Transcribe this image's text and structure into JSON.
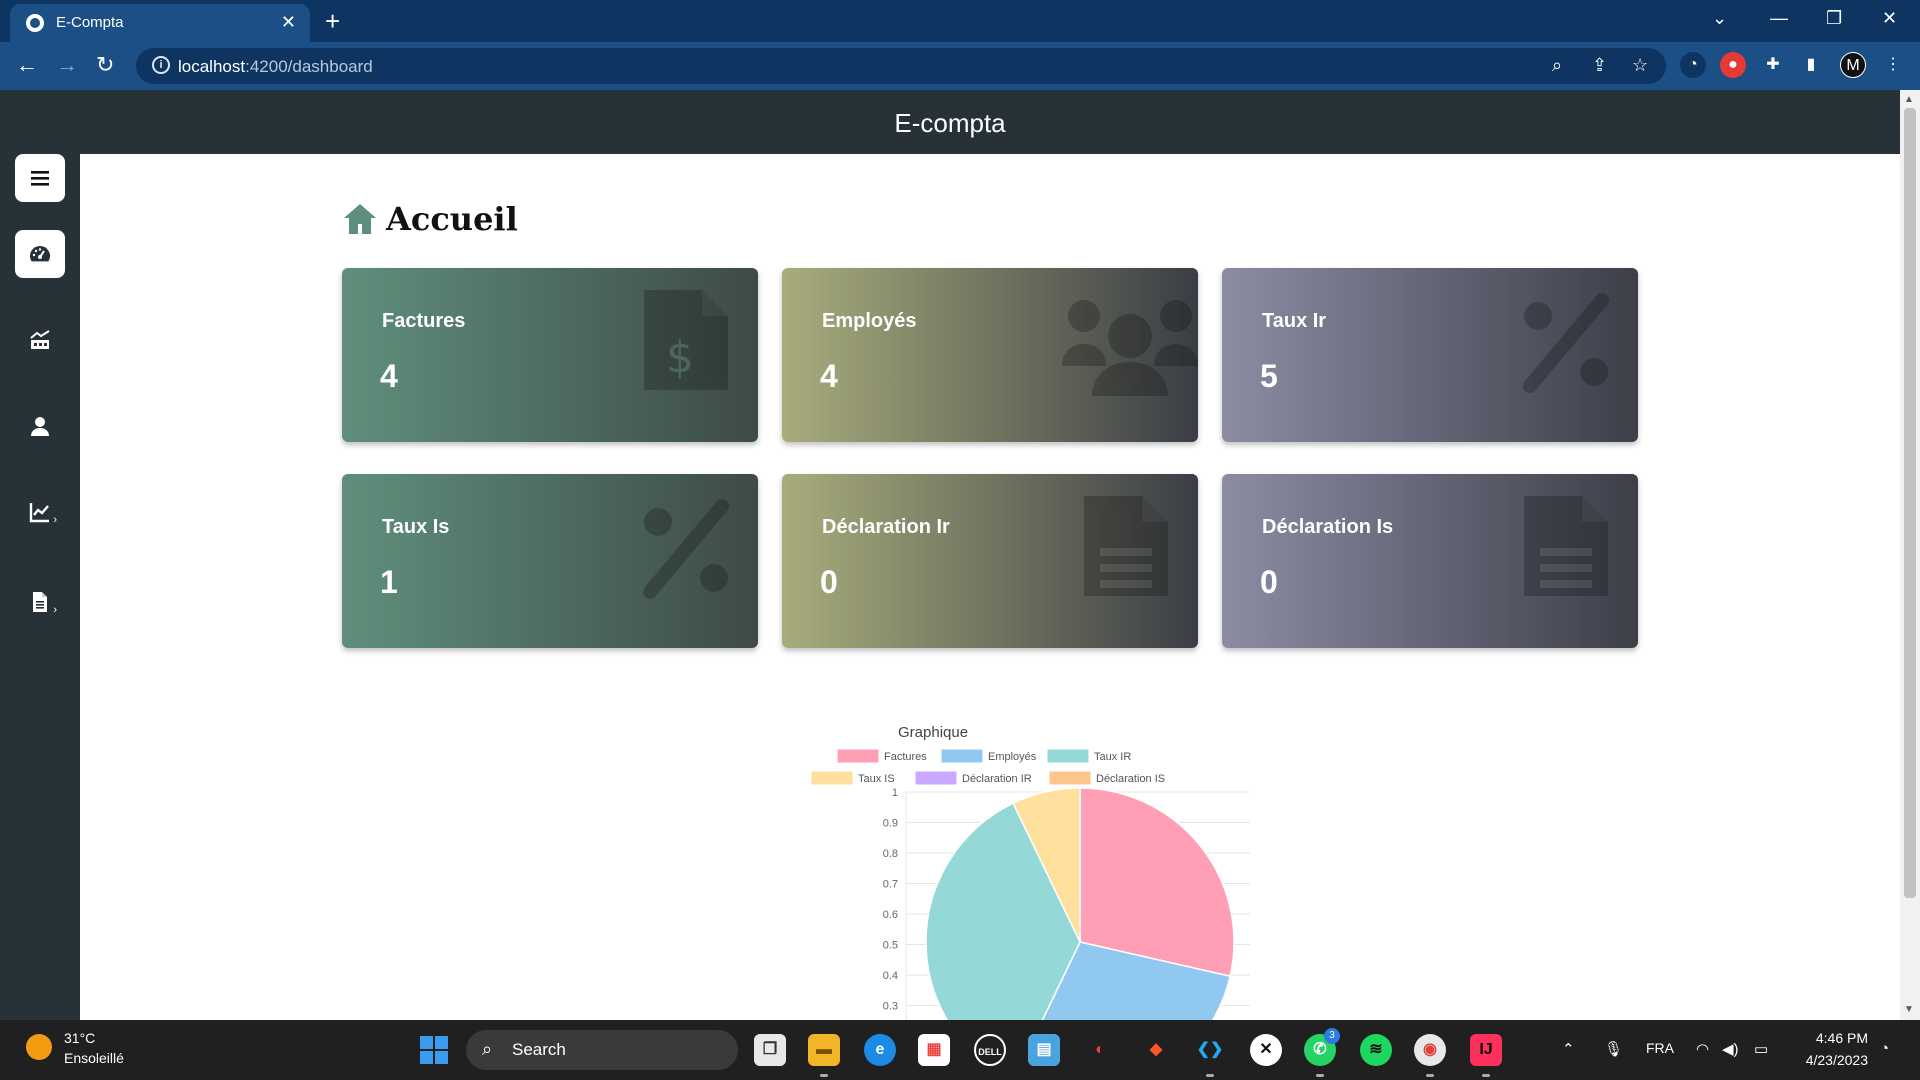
{
  "browser": {
    "tab_title": "E-Compta",
    "url_host": "localhost",
    "url_path": ":4200/dashboard",
    "tab_close": "✕",
    "new_tab": "+"
  },
  "app": {
    "header_title": "E-compta",
    "page_title": "Accueil",
    "accent_colors": {
      "header": "#263238",
      "green": "#5f8f7c",
      "olive": "#a9ad7c",
      "gray": "#8c8ca4"
    }
  },
  "sidebar": {
    "items": [
      {
        "icon": "menu-icon"
      },
      {
        "icon": "dashboard-icon",
        "active": true
      },
      {
        "icon": "chart-building-icon"
      },
      {
        "icon": "user-icon"
      },
      {
        "icon": "line-chart-icon",
        "caret": "›"
      },
      {
        "icon": "document-icon",
        "caret": "›"
      }
    ]
  },
  "cards": [
    {
      "label": "Factures",
      "value": "4",
      "icon": "invoice-dollar-icon"
    },
    {
      "label": "Employés",
      "value": "4",
      "icon": "users-icon"
    },
    {
      "label": "Taux Ir",
      "value": "5",
      "icon": "percent-icon"
    },
    {
      "label": "Taux Is",
      "value": "1",
      "icon": "percent-icon"
    },
    {
      "label": "Déclaration Ir",
      "value": "0",
      "icon": "file-lines-icon"
    },
    {
      "label": "Déclaration Is",
      "value": "0",
      "icon": "file-lines-icon"
    }
  ],
  "chart_data": {
    "type": "pie",
    "title": "Graphique",
    "categories": [
      "Factures",
      "Employés",
      "Taux IR",
      "Taux IS",
      "Déclaration IR",
      "Déclaration IS"
    ],
    "values": [
      4,
      4,
      5,
      1,
      0,
      0
    ],
    "colors": [
      "#ff9fb5",
      "#90c8ef",
      "#94d8d8",
      "#ffe09c",
      "#c9a8ff",
      "#ffc58f"
    ],
    "y_ticks": [
      "1",
      "0.9",
      "0.8",
      "0.7",
      "0.6",
      "0.5",
      "0.4",
      "0.3"
    ],
    "legend_position": "top",
    "grid": true
  },
  "taskbar": {
    "weather_temp": "31°C",
    "weather_desc": "Ensoleillé",
    "search_label": "Search",
    "language": "FRA",
    "time": "4:46 PM",
    "date": "4/23/2023",
    "whatsapp_badge": "3"
  }
}
